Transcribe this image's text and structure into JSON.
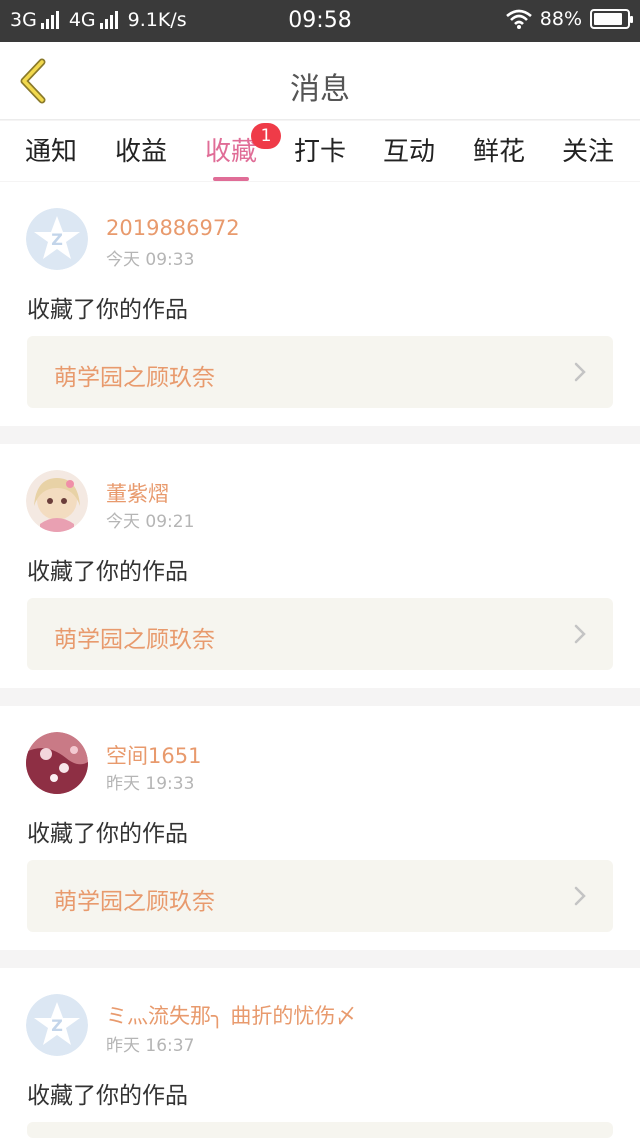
{
  "statusbar": {
    "left_text": "3G",
    "net2": "4G",
    "speed": "9.1K/s",
    "time": "09:58",
    "battery": "88%",
    "battery_level": 0.88
  },
  "header": {
    "title": "消息",
    "back_icon": "chevron-left-icon"
  },
  "tabs": [
    {
      "label": "通知",
      "active": false
    },
    {
      "label": "收益",
      "active": false
    },
    {
      "label": "收藏",
      "active": true,
      "badge": "1"
    },
    {
      "label": "打卡",
      "active": false
    },
    {
      "label": "互动",
      "active": false
    },
    {
      "label": "鲜花",
      "active": false
    },
    {
      "label": "关注",
      "active": false
    }
  ],
  "messages": [
    {
      "user": "2019886972",
      "time": "今天 09:33",
      "action": "收藏了你的作品",
      "work": "萌学园之顾玖奈",
      "avatar": "qzone-default-avatar"
    },
    {
      "user": "董紫熠",
      "time": "今天 09:21",
      "action": "收藏了你的作品",
      "work": "萌学园之顾玖奈",
      "avatar": "anime-girl-avatar"
    },
    {
      "user": "空间1651",
      "time": "昨天 19:33",
      "action": "收藏了你的作品",
      "work": "萌学园之顾玖奈",
      "avatar": "floral-photo-avatar"
    },
    {
      "user": "ミ灬流失那╮ 曲折的忧伤〆",
      "time": "昨天 16:37",
      "action": "收藏了你的作品",
      "work": "",
      "avatar": "qzone-default-avatar"
    }
  ],
  "colors": {
    "accent": "#e06d97",
    "username": "#e89a6d",
    "badge": "#ef3b48",
    "work_bg": "#f6f5ef"
  }
}
